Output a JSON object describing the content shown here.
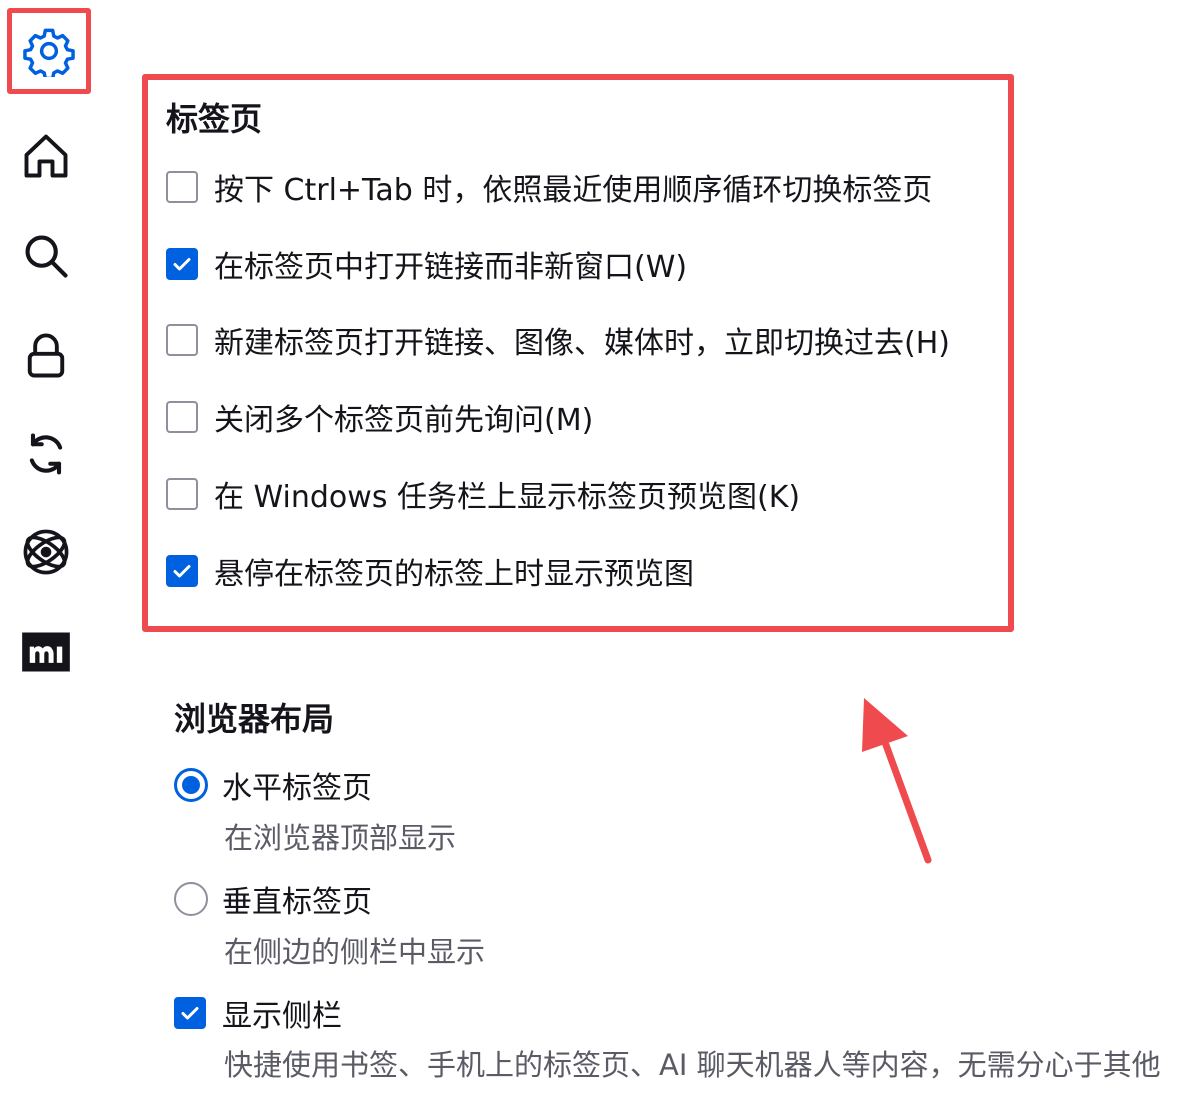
{
  "sidebar": {
    "items": [
      {
        "name": "general",
        "icon": "gear-icon",
        "selected": true
      },
      {
        "name": "home",
        "icon": "home-icon"
      },
      {
        "name": "search",
        "icon": "search-icon"
      },
      {
        "name": "privacy",
        "icon": "lock-icon"
      },
      {
        "name": "sync",
        "icon": "sync-icon"
      },
      {
        "name": "experiments",
        "icon": "atom-icon"
      },
      {
        "name": "more-from-mozilla",
        "icon": "mozilla-m-icon"
      }
    ]
  },
  "tabs_section": {
    "title": "标签页",
    "options": [
      {
        "label": "按下 Ctrl+Tab 时，依照最近使用顺序循环切换标签页",
        "checked": false
      },
      {
        "label": "在标签页中打开链接而非新窗口(W)",
        "checked": true
      },
      {
        "label": "新建标签页打开链接、图像、媒体时，立即切换过去(H)",
        "checked": false
      },
      {
        "label": "关闭多个标签页前先询问(M)",
        "checked": false
      },
      {
        "label": "在 Windows 任务栏上显示标签页预览图(K)",
        "checked": false
      },
      {
        "label": "悬停在标签页的标签上时显示预览图",
        "checked": true
      }
    ]
  },
  "layout_section": {
    "title": "浏览器布局",
    "horizontal": {
      "label": "水平标签页",
      "desc": "在浏览器顶部显示",
      "selected": true
    },
    "vertical": {
      "label": "垂直标签页",
      "desc": "在侧边的侧栏中显示",
      "selected": false
    },
    "sidebar": {
      "label": "显示侧栏",
      "desc": "快捷使用书签、手机上的标签页、AI 聊天机器人等内容，无需分心于其他",
      "checked": true
    }
  },
  "colors": {
    "accent": "#0061e0",
    "highlight": "#ef4b4f",
    "text": "#15141a",
    "secondary_text": "#5b5b66"
  }
}
